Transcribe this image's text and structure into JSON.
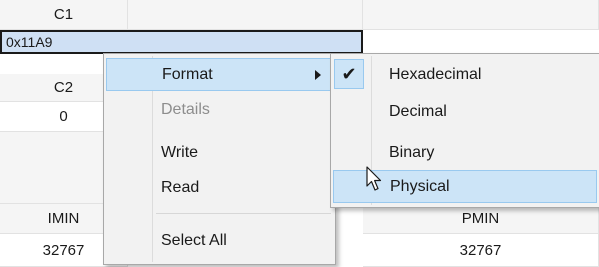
{
  "table": {
    "c1_header": "C1",
    "selected_value": "0x11A9",
    "c2_header": "C2",
    "c2_value": "0",
    "imin_header": "IMIN",
    "imin_value": "32767",
    "pmin_header": "PMIN",
    "pmin_value": "32767"
  },
  "context_menu": {
    "items": [
      {
        "label": "Format",
        "has_submenu": true,
        "highlighted": true,
        "enabled": true
      },
      {
        "label": "Details",
        "enabled": false
      },
      {
        "label": "Write",
        "enabled": true
      },
      {
        "label": "Read",
        "enabled": true
      },
      {
        "label": "Select All",
        "enabled": true
      }
    ]
  },
  "format_submenu": {
    "items": [
      {
        "label": "Hexadecimal",
        "checked": true
      },
      {
        "label": "Decimal",
        "checked": false
      },
      {
        "label": "Binary",
        "checked": false
      },
      {
        "label": "Physical",
        "checked": false,
        "highlighted": true
      }
    ],
    "check_glyph": "✔"
  },
  "icons": {
    "submenu_arrow": "chevron-right-icon",
    "checkmark": "checkmark-icon",
    "cursor": "mouse-pointer-icon"
  },
  "colors": {
    "highlight": "#cce4f7",
    "highlight_border": "#99c9ef",
    "selected_cell": "#cfe0f4",
    "menu_bg": "#f2f2f2"
  }
}
